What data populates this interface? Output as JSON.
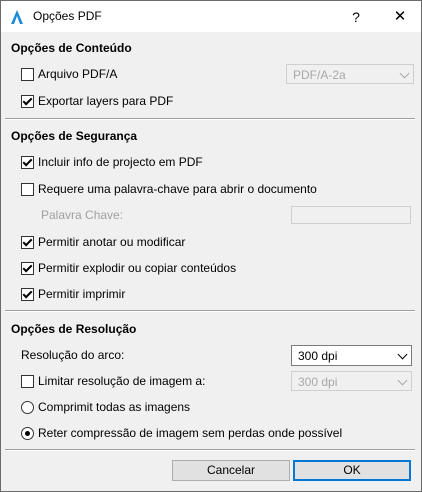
{
  "window": {
    "title": "Opções PDF",
    "help_label": "?",
    "close_label": "✕"
  },
  "content_options": {
    "header": "Opções de Conteúdo",
    "pdfa": {
      "label": "Arquivo PDF/A",
      "checked": false
    },
    "pdfa_combo": {
      "value": "PDF/A-2a",
      "enabled": false
    },
    "export_layers": {
      "label": "Exportar layers para PDF",
      "checked": true
    }
  },
  "security_options": {
    "header": "Opções de Segurança",
    "include_project_info": {
      "label": "Incluir info de projecto em PDF",
      "checked": true
    },
    "require_password": {
      "label": "Requere uma palavra-chave para abrir o documento",
      "checked": false
    },
    "password_label": "Palavra Chave:",
    "password_value": "",
    "allow_annotate": {
      "label": "Permitir anotar ou modificar",
      "checked": true
    },
    "allow_extract": {
      "label": "Permitir explodir ou copiar conteúdos",
      "checked": true
    },
    "allow_print": {
      "label": "Permitir imprimir",
      "checked": true
    }
  },
  "resolution_options": {
    "header": "Opções de Resolução",
    "arc_resolution_label": "Resolução do arco:",
    "arc_resolution_value": "300 dpi",
    "limit_image_resolution": {
      "label": "Limitar resolução de imagem a:",
      "checked": false
    },
    "image_resolution_value": "300 dpi",
    "compress_all": {
      "label": "Comprimit todas as imagens",
      "selected": false
    },
    "retain_lossless": {
      "label": "Reter compressão de imagem sem perdas onde possível",
      "selected": true
    }
  },
  "buttons": {
    "cancel": "Cancelar",
    "ok": "OK"
  },
  "colors": {
    "accent": "#0078d7",
    "window_bg": "#f0f0f0",
    "disabled_text": "#a0a0a0"
  }
}
